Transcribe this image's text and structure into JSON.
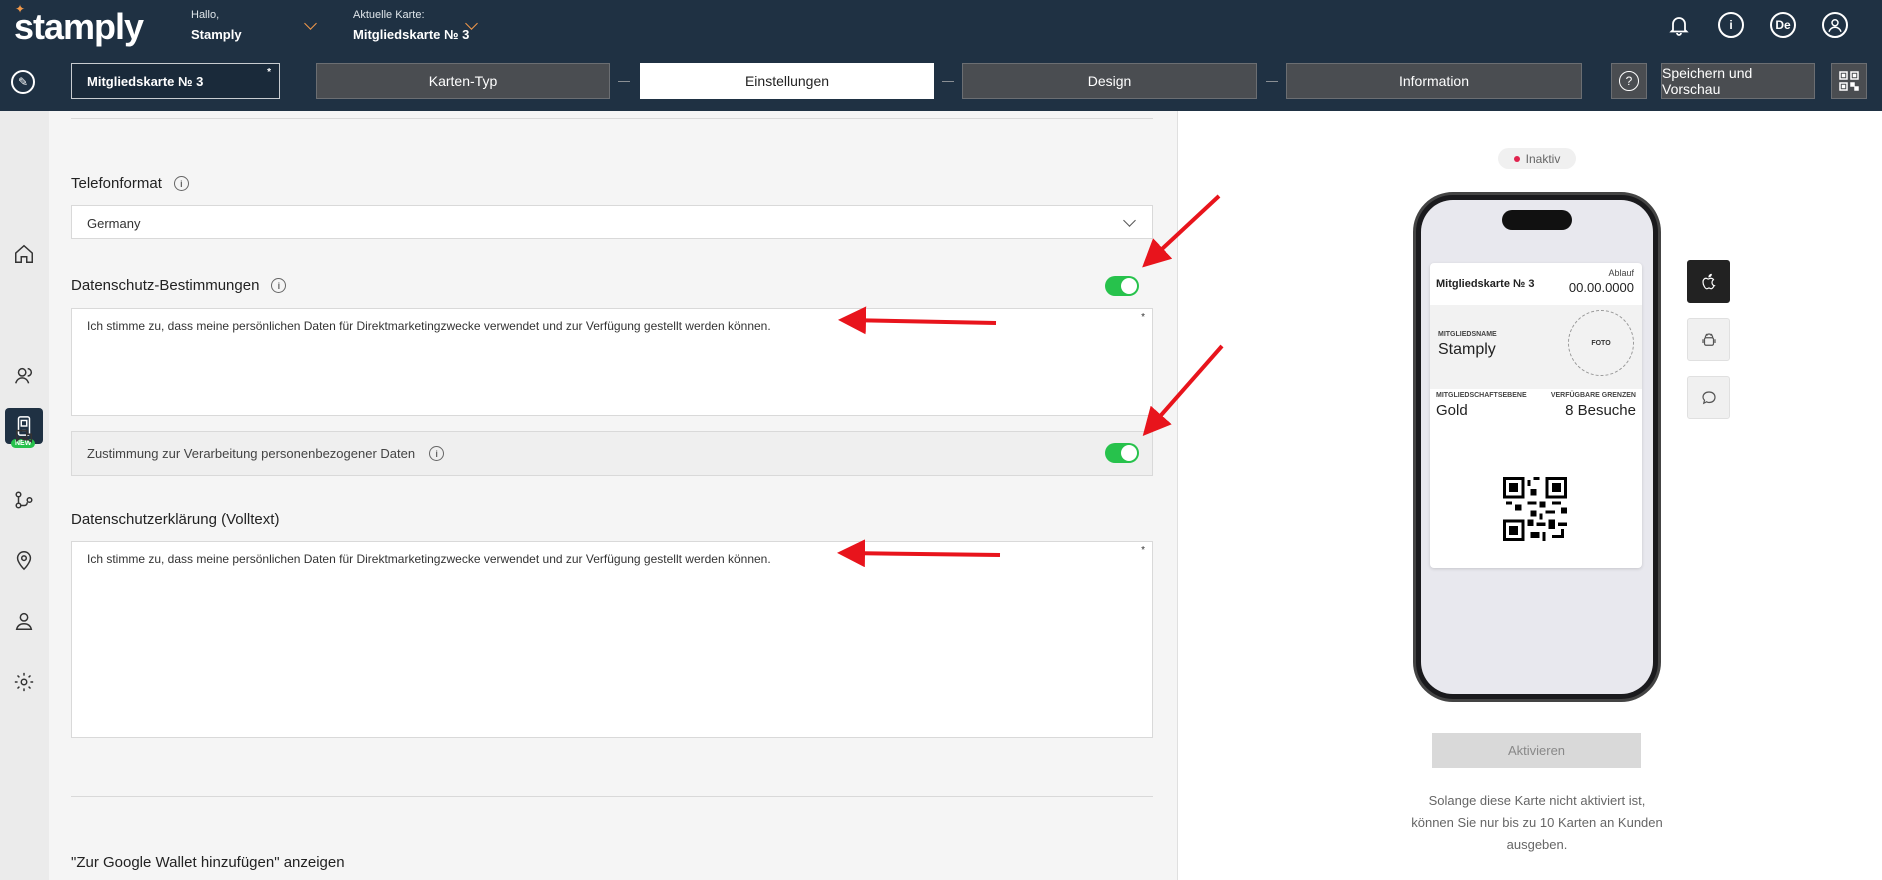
{
  "header": {
    "logo": "stamply",
    "greeting_label": "Hallo,",
    "greeting_name": "Stamply",
    "card_label": "Aktuelle Karte:",
    "card_name": "Mitgliedskarte № 3",
    "lang": "De",
    "info": "i"
  },
  "toolbar": {
    "card_name": "Mitgliedskarte № 3",
    "required": "*",
    "steps": [
      "Karten-Typ",
      "Einstellungen",
      "Design",
      "Information"
    ],
    "help": "?",
    "save_label": "Speichern und Vorschau"
  },
  "form": {
    "phone_label": "Telefonformat",
    "phone_value": "Germany",
    "privacy_label": "Datenschutz-Bestimmungen",
    "privacy_text": "Ich stimme zu, dass meine persönlichen Daten für Direktmarketingzwecke verwendet und zur Verfügung gestellt werden können.",
    "consent_label": "Zustimmung zur Verarbeitung personenbezogener Daten",
    "fulltext_label": "Datenschutzerklärung (Volltext)",
    "fulltext_text": "Ich stimme zu, dass meine persönlichen Daten für Direktmarketingzwecke verwendet und zur Verfügung gestellt werden können.",
    "google_wallet_label": "\"Zur Google Wallet hinzufügen\" anzeigen",
    "required": "*",
    "info": "i"
  },
  "preview": {
    "status": "Inaktiv",
    "card_title": "Mitgliedskarte № 3",
    "expiry_label": "Ablauf",
    "expiry_value": "00.00.0000",
    "member_label": "MITGLIEDSNAME",
    "member_value": "Stamply",
    "photo_label": "FOTO",
    "level_label": "MITGLIEDSCHAFTSEBENE",
    "level_value": "Gold",
    "limits_label": "VERFÜGBARE GRENZEN",
    "limits_value": "8 Besuche",
    "activate_label": "Aktivieren",
    "note": "Solange diese Karte nicht aktiviert ist, können Sie nur bis zu 10 Karten an Kunden ausgeben."
  },
  "sidebar": {
    "new_badge": "NEW"
  },
  "colors": {
    "header_bg": "#1f3143",
    "accent_orange": "#f2994a",
    "toggle_green": "#27c24c",
    "status_red": "#e0234e",
    "annotation_red": "#e8141c"
  }
}
